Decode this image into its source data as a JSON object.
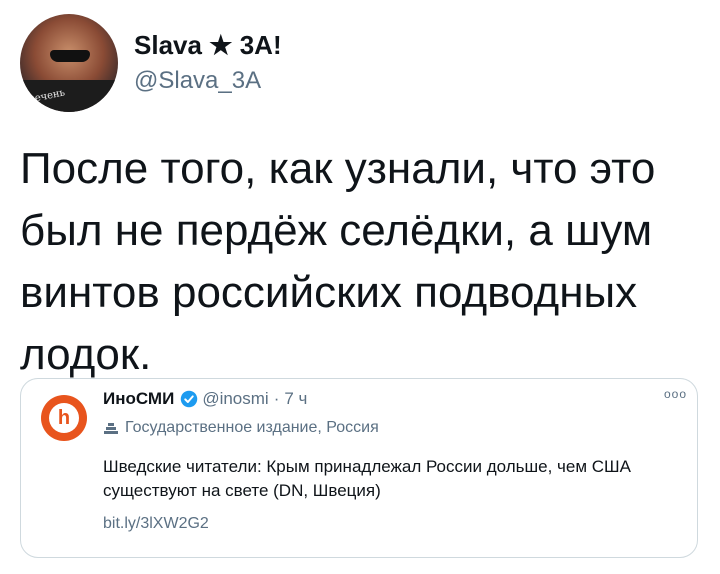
{
  "author": {
    "display_name": "Slava ★ 3A!",
    "handle": "@Slava_3A",
    "avatar_shirt_text": "печень"
  },
  "tweet": {
    "text": "После того, как узнали, что это был не пердёж селёдки, а шум винтов российских подводных лодок."
  },
  "quoted": {
    "display_name": "ИноСМИ",
    "handle": "@inosmi",
    "separator": "·",
    "time": "7 ч",
    "label": "Государственное издание, Россия",
    "text": "Шведские читатели: Крым принадлежал России дольше, чем США существуют на свете (DN, Швеция)",
    "link": "bit.ly/3lXW2G2",
    "avatar_letter": "h",
    "more": "ooo"
  },
  "colors": {
    "accent": "#1d9bf0",
    "secondary_text": "#5b7083",
    "inosmi_orange": "#e8541d"
  }
}
